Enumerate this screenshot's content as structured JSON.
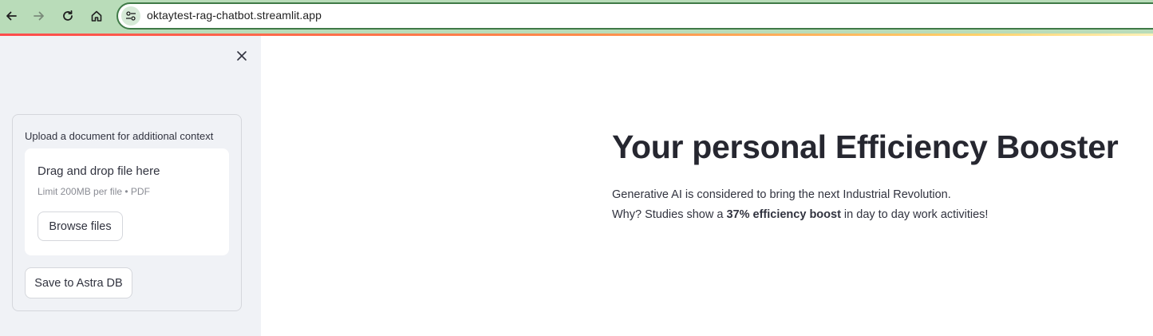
{
  "browser": {
    "url": "oktaytest-rag-chatbot.streamlit.app"
  },
  "sidebar": {
    "upload_label": "Upload a document for additional context",
    "dropzone_title": "Drag and drop file here",
    "dropzone_limit": "Limit 200MB per file • PDF",
    "browse_button": "Browse files",
    "save_button": "Save to Astra DB"
  },
  "main": {
    "title": "Your personal Efficiency Booster",
    "line1": "Generative AI is considered to bring the next Industrial Revolution.",
    "line2_prefix": "Why? Studies show a ",
    "line2_bold": "37% efficiency boost",
    "line2_suffix": " in day to day work activities!"
  },
  "colors": {
    "chrome": "#b9dcb9",
    "omnibox_border": "#3f7a47",
    "sidebar_bg": "#f0f2f6",
    "text": "#31333f",
    "title": "#262730"
  }
}
